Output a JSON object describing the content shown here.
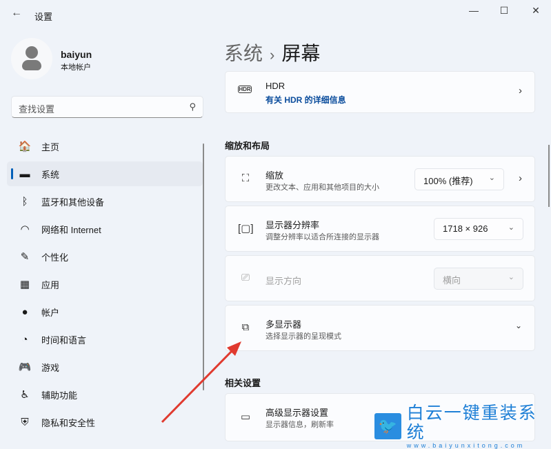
{
  "window": {
    "title": "设置",
    "back": "←",
    "minimize": "—",
    "maximize": "☐",
    "close": "✕"
  },
  "user": {
    "name": "baiyun",
    "account_type": "本地帐户"
  },
  "search": {
    "placeholder": "查找设置"
  },
  "sidebar": {
    "items": [
      {
        "label": "主页",
        "icon": "home-icon",
        "glyph": "🏠"
      },
      {
        "label": "系统",
        "icon": "system-icon",
        "glyph": "▬",
        "selected": true
      },
      {
        "label": "蓝牙和其他设备",
        "icon": "bluetooth-icon",
        "glyph": "ᛒ"
      },
      {
        "label": "网络和 Internet",
        "icon": "wifi-icon",
        "glyph": "◠"
      },
      {
        "label": "个性化",
        "icon": "brush-icon",
        "glyph": "✎"
      },
      {
        "label": "应用",
        "icon": "apps-icon",
        "glyph": "▦"
      },
      {
        "label": "帐户",
        "icon": "account-icon",
        "glyph": "●"
      },
      {
        "label": "时间和语言",
        "icon": "globe-clock-icon",
        "glyph": "◔"
      },
      {
        "label": "游戏",
        "icon": "gamepad-icon",
        "glyph": "🎮"
      },
      {
        "label": "辅助功能",
        "icon": "accessibility-icon",
        "glyph": "♿"
      },
      {
        "label": "隐私和安全性",
        "icon": "shield-icon",
        "glyph": "⛨"
      }
    ]
  },
  "breadcrumb": {
    "parent": "系统",
    "sep": "›",
    "current": "屏幕"
  },
  "hdr": {
    "title": "HDR",
    "link": "有关 HDR 的详细信息",
    "icon_text": "HDR"
  },
  "scale_layout": {
    "heading": "缩放和布局",
    "scale": {
      "title": "缩放",
      "desc": "更改文本、应用和其他项目的大小",
      "value": "100% (推荐)"
    },
    "resolution": {
      "title": "显示器分辨率",
      "desc": "调整分辨率以适合所连接的显示器",
      "value": "1718 × 926"
    },
    "orientation": {
      "title": "显示方向",
      "value": "横向",
      "disabled": true
    },
    "multi": {
      "title": "多显示器",
      "desc": "选择显示器的呈现模式"
    }
  },
  "related": {
    "heading": "相关设置",
    "advanced": {
      "title": "高级显示器设置",
      "desc": "显示器信息，刷新率"
    }
  },
  "watermark": {
    "brand": "白云一键重装系统",
    "url": "www.baiyunxitong.com"
  },
  "colors": {
    "accent": "#005fb8",
    "link": "#0a4c9c",
    "annotation_arrow": "#e03a2f"
  }
}
